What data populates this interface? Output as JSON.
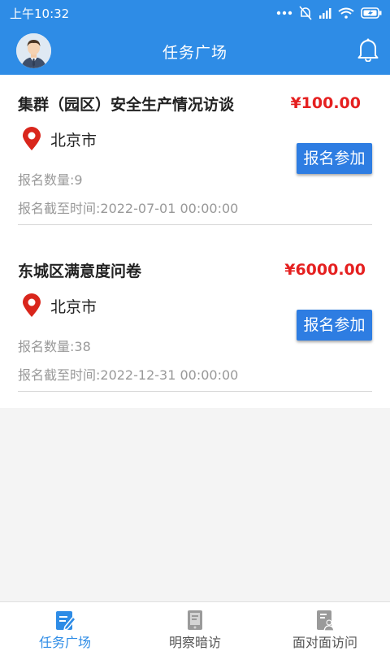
{
  "status_bar": {
    "time": "上午10:32"
  },
  "header": {
    "title": "任务广场"
  },
  "tasks": [
    {
      "title": "集群（园区）安全生产情况访谈",
      "price": "¥100.00",
      "location": "北京市",
      "count": "报名数量:9",
      "deadline": "报名截至时间:2022-07-01 00:00:00",
      "button": "报名参加"
    },
    {
      "title": "东城区满意度问卷",
      "price": "¥6000.00",
      "location": "北京市",
      "count": "报名数量:38",
      "deadline": "报名截至时间:2022-12-31 00:00:00",
      "button": "报名参加"
    }
  ],
  "tabs": [
    {
      "label": "任务广场",
      "active": true,
      "icon": "edit-document-icon"
    },
    {
      "label": "明察暗访",
      "active": false,
      "icon": "phone-document-icon"
    },
    {
      "label": "面对面访问",
      "active": false,
      "icon": "person-document-icon"
    }
  ],
  "colors": {
    "primary": "#2e8ce6",
    "price": "#e52020",
    "pin": "#d9261c"
  }
}
